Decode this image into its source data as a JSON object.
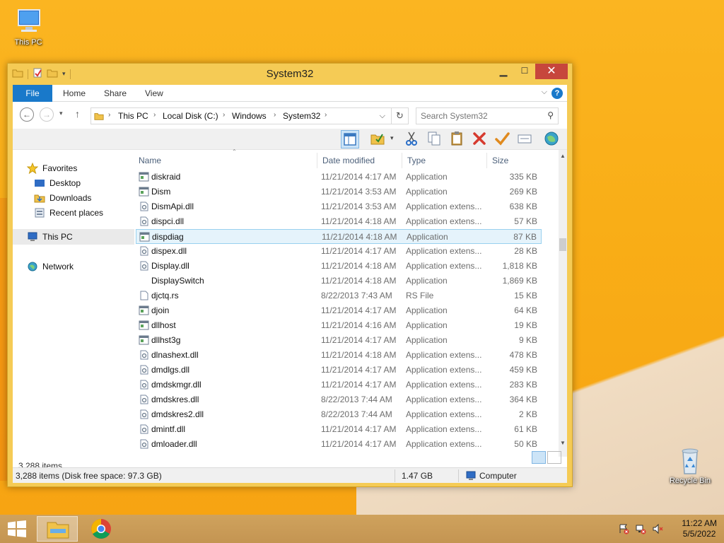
{
  "desktop": {
    "icons": {
      "this_pc": "This PC",
      "recycle_bin": "Recycle Bin"
    }
  },
  "window": {
    "title": "System32",
    "ribbon_tabs": [
      "File",
      "Home",
      "Share",
      "View"
    ],
    "breadcrumb": [
      "This PC",
      "Local Disk (C:)",
      "Windows",
      "System32"
    ],
    "search_placeholder": "Search System32",
    "nav": {
      "favorites": "Favorites",
      "desktop": "Desktop",
      "downloads": "Downloads",
      "recent": "Recent places",
      "this_pc": "This PC",
      "network": "Network"
    },
    "columns": [
      "Name",
      "Date modified",
      "Type",
      "Size"
    ],
    "files": [
      {
        "name": "diskraid",
        "date": "11/21/2014 4:17 AM",
        "type": "Application",
        "size": "335 KB",
        "icon": "app"
      },
      {
        "name": "Dism",
        "date": "11/21/2014 3:53 AM",
        "type": "Application",
        "size": "269 KB",
        "icon": "app"
      },
      {
        "name": "DismApi.dll",
        "date": "11/21/2014 3:53 AM",
        "type": "Application extens...",
        "size": "638 KB",
        "icon": "dll"
      },
      {
        "name": "dispci.dll",
        "date": "11/21/2014 4:18 AM",
        "type": "Application extens...",
        "size": "57 KB",
        "icon": "dll"
      },
      {
        "name": "dispdiag",
        "date": "11/21/2014 4:18 AM",
        "type": "Application",
        "size": "87 KB",
        "icon": "app",
        "selected": true
      },
      {
        "name": "dispex.dll",
        "date": "11/21/2014 4:17 AM",
        "type": "Application extens...",
        "size": "28 KB",
        "icon": "dll"
      },
      {
        "name": "Display.dll",
        "date": "11/21/2014 4:18 AM",
        "type": "Application extens...",
        "size": "1,818 KB",
        "icon": "dll"
      },
      {
        "name": "DisplaySwitch",
        "date": "11/21/2014 4:18 AM",
        "type": "Application",
        "size": "1,869 KB",
        "icon": "none"
      },
      {
        "name": "djctq.rs",
        "date": "8/22/2013 7:43 AM",
        "type": "RS File",
        "size": "15 KB",
        "icon": "file"
      },
      {
        "name": "djoin",
        "date": "11/21/2014 4:17 AM",
        "type": "Application",
        "size": "64 KB",
        "icon": "app"
      },
      {
        "name": "dllhost",
        "date": "11/21/2014 4:16 AM",
        "type": "Application",
        "size": "19 KB",
        "icon": "app"
      },
      {
        "name": "dllhst3g",
        "date": "11/21/2014 4:17 AM",
        "type": "Application",
        "size": "9 KB",
        "icon": "app"
      },
      {
        "name": "dlnashext.dll",
        "date": "11/21/2014 4:18 AM",
        "type": "Application extens...",
        "size": "478 KB",
        "icon": "dll"
      },
      {
        "name": "dmdlgs.dll",
        "date": "11/21/2014 4:17 AM",
        "type": "Application extens...",
        "size": "459 KB",
        "icon": "dll"
      },
      {
        "name": "dmdskmgr.dll",
        "date": "11/21/2014 4:17 AM",
        "type": "Application extens...",
        "size": "283 KB",
        "icon": "dll"
      },
      {
        "name": "dmdskres.dll",
        "date": "8/22/2013 7:44 AM",
        "type": "Application extens...",
        "size": "364 KB",
        "icon": "dll"
      },
      {
        "name": "dmdskres2.dll",
        "date": "8/22/2013 7:44 AM",
        "type": "Application extens...",
        "size": "2 KB",
        "icon": "dll"
      },
      {
        "name": "dmintf.dll",
        "date": "11/21/2014 4:17 AM",
        "type": "Application extens...",
        "size": "61 KB",
        "icon": "dll"
      },
      {
        "name": "dmloader.dll",
        "date": "11/21/2014 4:17 AM",
        "type": "Application extens...",
        "size": "50 KB",
        "icon": "dll"
      }
    ],
    "item_count": "3,288 items",
    "status": {
      "summary": "3,288 items (Disk free space: 97.3 GB)",
      "size": "1.47 GB",
      "location": "Computer"
    }
  },
  "taskbar": {
    "clock_time": "11:22 AM",
    "clock_date": "5/5/2022"
  },
  "colors": {
    "accent": "#1979ca",
    "window_frame": "#f5cb55",
    "close_button": "#c7463c",
    "selection": "#e5f3fb"
  }
}
